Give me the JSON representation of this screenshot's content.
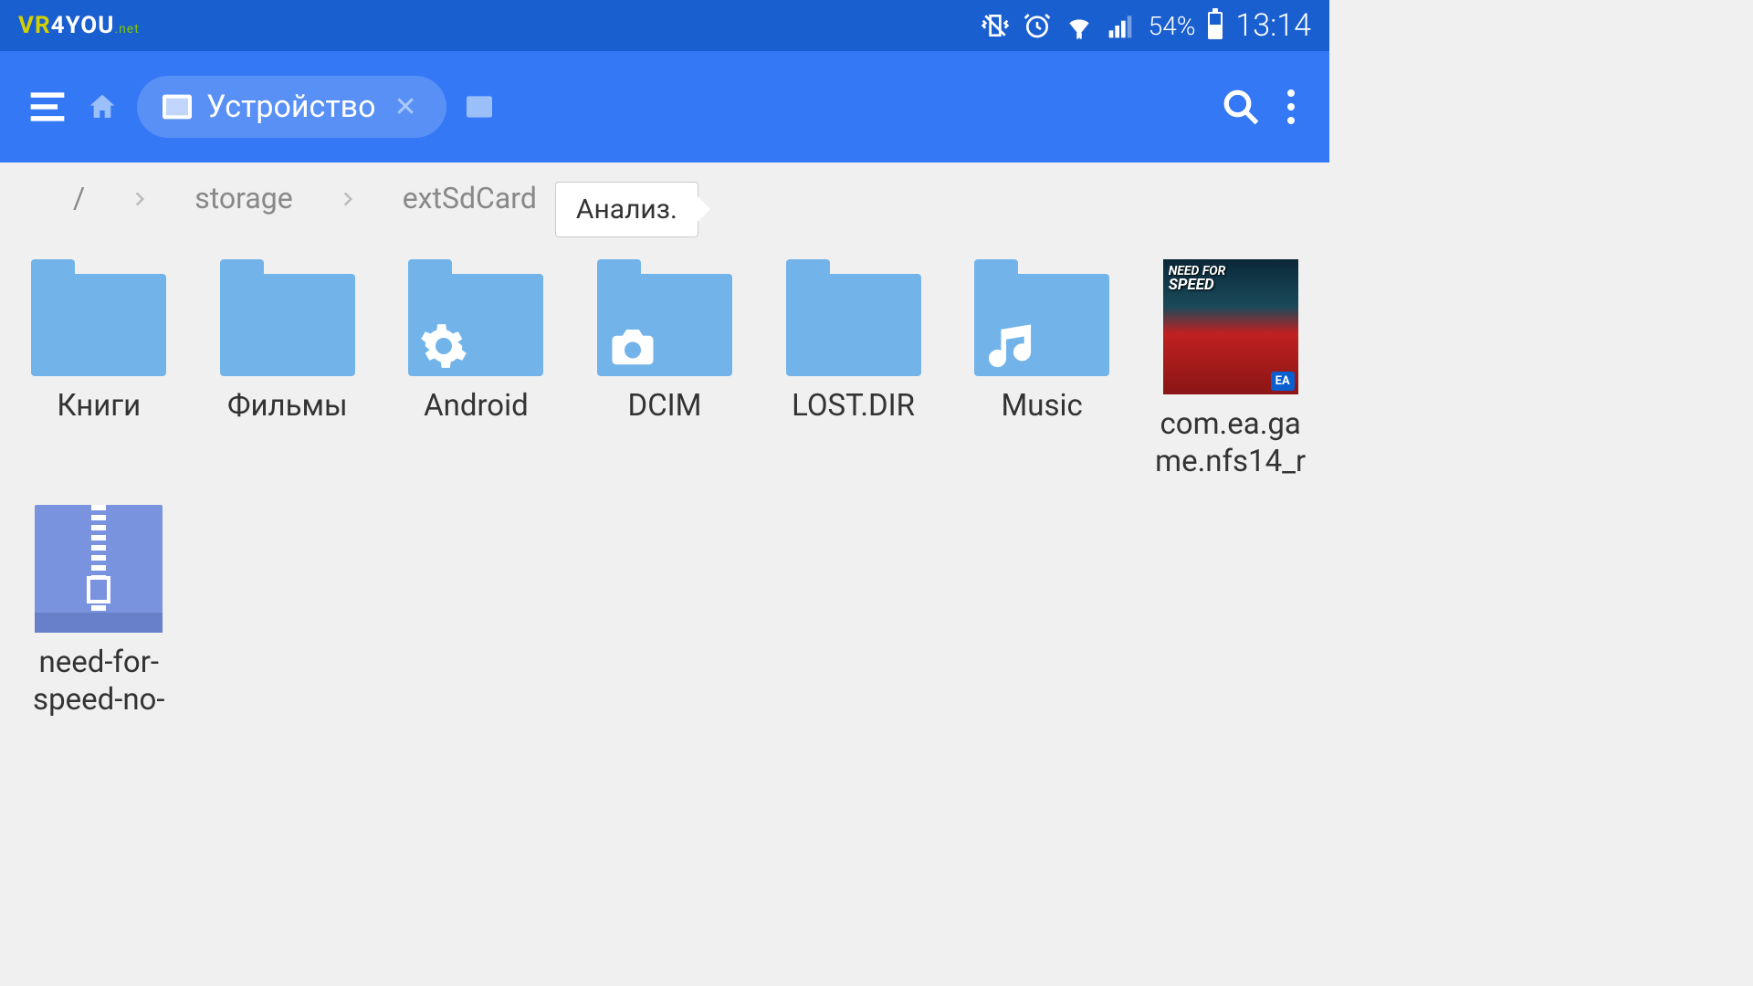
{
  "status": {
    "logo_vr": "VR",
    "logo_4": "4",
    "logo_you": "YOU",
    "logo_net": ".net",
    "battery_pct": "54%",
    "time": "13:14"
  },
  "appbar": {
    "tab_label": "Устройство"
  },
  "breadcrumb": {
    "root": "/",
    "seg1": "storage",
    "seg2": "extSdCard",
    "analyze": "Анализ."
  },
  "items": [
    {
      "name": "Книги",
      "type": "folder"
    },
    {
      "name": "Фильмы",
      "type": "folder"
    },
    {
      "name": "Android",
      "type": "folder",
      "overlay": "gear"
    },
    {
      "name": "DCIM",
      "type": "folder",
      "overlay": "camera"
    },
    {
      "name": "LOST.DIR",
      "type": "folder"
    },
    {
      "name": "Music",
      "type": "folder",
      "overlay": "music"
    },
    {
      "name": "com.ea.game.nfs14_r",
      "type": "thumb",
      "thumb_top": "NEED FOR",
      "thumb_top2": "SPEED",
      "badge": "EA"
    },
    {
      "name": "need-for-speed-no-",
      "type": "zip"
    }
  ]
}
